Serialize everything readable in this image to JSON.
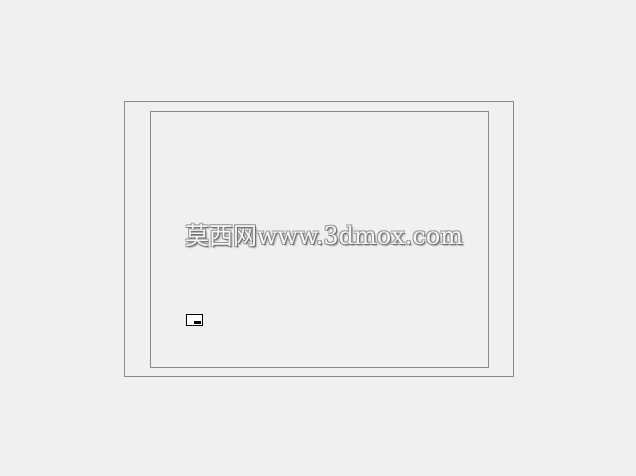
{
  "watermark": {
    "text": "莫西网www.3dmox.com"
  },
  "icons": {
    "restore": "restore-window-icon"
  }
}
